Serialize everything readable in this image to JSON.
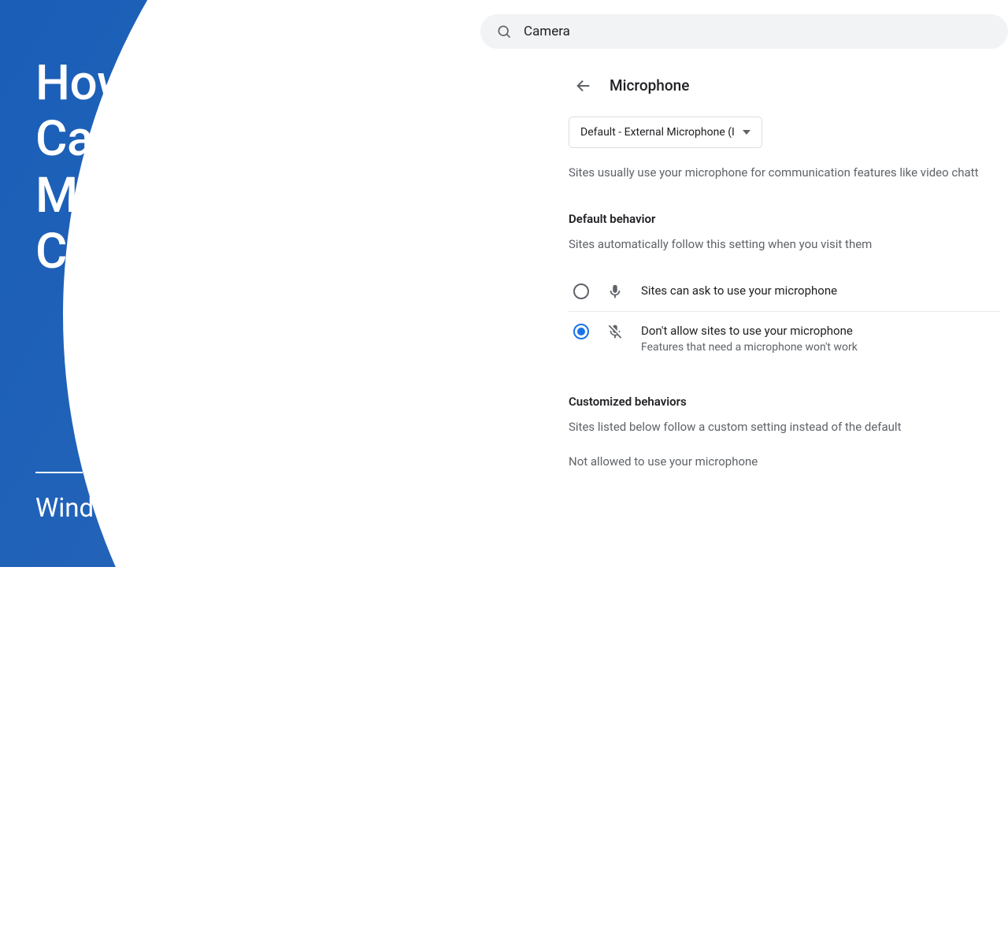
{
  "titleCard": {
    "title": "How to Allow Your Camera and Microphone on Google Chrome",
    "subtitle": "Windows Tutorial"
  },
  "settings": {
    "searchQuery": "Camera",
    "pageTitle": "Microphone",
    "dropdownLabel": "Default - External Microphone (I",
    "description": "Sites usually use your microphone for communication features like video chatt",
    "defaultBehavior": {
      "heading": "Default behavior",
      "sub": "Sites automatically follow this setting when you visit them",
      "option1": "Sites can ask to use your microphone",
      "option2Title": "Don't allow sites to use your microphone",
      "option2Sub": "Features that need a microphone won't work"
    },
    "customized": {
      "heading": "Customized behaviors",
      "sub": "Sites listed below follow a custom setting instead of the default",
      "notAllowed": "Not allowed to use your microphone"
    }
  }
}
